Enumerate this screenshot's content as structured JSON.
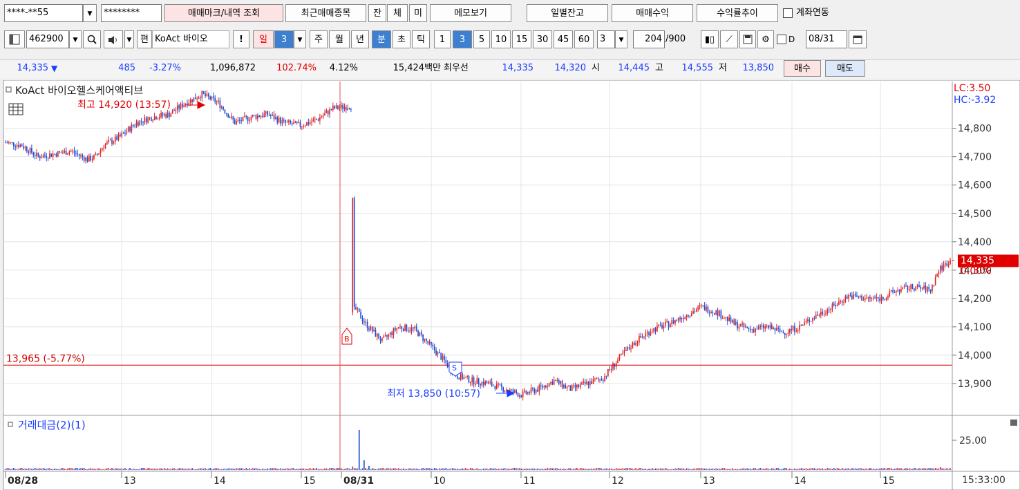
{
  "toolbar1": {
    "account_masked": "****-**55",
    "password_masked": "********",
    "trade_mark_button": "매매마크/내역 조회",
    "recent_trades_button": "최근매매종목",
    "tab_jan": "잔",
    "tab_che": "체",
    "tab_mi": "미",
    "memo_button": "메모보기",
    "daily_balance_button": "일별잔고",
    "trade_profit_button": "매매수익",
    "return_trend_button": "수익률추이",
    "account_link_label": "계좌연동"
  },
  "toolbar2": {
    "stock_code": "462900",
    "pyeon_label": "편",
    "stock_name": "KoAct 바이오",
    "alert_label": "!",
    "period_day": "일",
    "period_value": "3",
    "week": "주",
    "month": "월",
    "year": "년",
    "minute": "분",
    "second": "초",
    "tick": "틱",
    "intervals": [
      "1",
      "3",
      "5",
      "10",
      "15",
      "30",
      "45",
      "60"
    ],
    "selected_interval": "3",
    "custom_interval": "3",
    "count_value": "204",
    "count_max": "/900",
    "d_label": "D",
    "date_value": "08/31"
  },
  "quote": {
    "price": "14,335",
    "change_arrow": "▼",
    "change": "485",
    "change_pct": "-3.27%",
    "volume": "1,096,872",
    "volume_ratio": "102.74%",
    "turnover_pct": "4.12%",
    "amount": "15,424백만",
    "best_label": "최우선",
    "ask": "14,335",
    "bid": "14,320",
    "open_label": "시",
    "open": "14,445",
    "high_label": "고",
    "high": "14,555",
    "low_label": "저",
    "low": "13,850",
    "buy_button": "매수",
    "sell_button": "매도"
  },
  "chart": {
    "title": "KoAct 바이오헬스케어액티브",
    "lc_label": "LC:3.50",
    "hc_label": "HC:-3.92",
    "high_annotation": "최고 14,920 (13:57)",
    "low_annotation": "최저 13,850 (10:57)",
    "ref_line_label": "13,965 (-5.77%)",
    "current_price_label": "14,335",
    "current_change_label": "0.00%",
    "volume_title": "거래대금(2)(1)",
    "volume_axis_label": "25.00",
    "time_label": "15:33:00",
    "buy_marker": "B",
    "sell_marker": "S"
  },
  "chart_data": {
    "type": "candlestick",
    "y_ticks": [
      "14,800",
      "14,700",
      "14,600",
      "14,500",
      "14,400",
      "14,300",
      "14,200",
      "14,100",
      "14,000",
      "13,900"
    ],
    "x_labels": [
      "08/28",
      "13",
      "14",
      "15",
      "08/31",
      "10",
      "11",
      "12",
      "13",
      "14",
      "15"
    ],
    "ylim": [
      13800,
      14960
    ],
    "reference_price": 13965,
    "close_path": [
      [
        0,
        14750
      ],
      [
        10,
        14740
      ],
      [
        20,
        14700
      ],
      [
        30,
        14710
      ],
      [
        40,
        14720
      ],
      [
        50,
        14690
      ],
      [
        55,
        14700
      ],
      [
        60,
        14740
      ],
      [
        70,
        14770
      ],
      [
        80,
        14820
      ],
      [
        90,
        14840
      ],
      [
        100,
        14850
      ],
      [
        110,
        14890
      ],
      [
        120,
        14920
      ],
      [
        130,
        14890
      ],
      [
        140,
        14820
      ],
      [
        150,
        14840
      ],
      [
        160,
        14850
      ],
      [
        170,
        14820
      ],
      [
        180,
        14810
      ],
      [
        190,
        14830
      ],
      [
        200,
        14870
      ],
      [
        212,
        14880
      ],
      [
        212,
        14550
      ],
      [
        213,
        14170
      ],
      [
        220,
        14110
      ],
      [
        230,
        14050
      ],
      [
        240,
        14100
      ],
      [
        250,
        14090
      ],
      [
        255,
        14060
      ],
      [
        265,
        14000
      ],
      [
        275,
        13930
      ],
      [
        285,
        13910
      ],
      [
        295,
        13900
      ],
      [
        305,
        13880
      ],
      [
        315,
        13860
      ],
      [
        325,
        13880
      ],
      [
        335,
        13910
      ],
      [
        345,
        13880
      ],
      [
        355,
        13900
      ],
      [
        365,
        13920
      ],
      [
        375,
        13990
      ],
      [
        385,
        14050
      ],
      [
        395,
        14090
      ],
      [
        405,
        14110
      ],
      [
        415,
        14140
      ],
      [
        425,
        14170
      ],
      [
        435,
        14150
      ],
      [
        445,
        14110
      ],
      [
        455,
        14090
      ],
      [
        465,
        14100
      ],
      [
        475,
        14080
      ],
      [
        485,
        14100
      ],
      [
        495,
        14140
      ],
      [
        505,
        14170
      ],
      [
        515,
        14210
      ],
      [
        525,
        14200
      ],
      [
        535,
        14200
      ],
      [
        545,
        14230
      ],
      [
        555,
        14240
      ],
      [
        565,
        14230
      ],
      [
        570,
        14300
      ],
      [
        577,
        14335
      ]
    ],
    "volume_spikes": [
      [
        212,
        5
      ],
      [
        216,
        58
      ],
      [
        219,
        14
      ],
      [
        222,
        6
      ],
      [
        545,
        3
      ],
      [
        571,
        4
      ]
    ]
  }
}
